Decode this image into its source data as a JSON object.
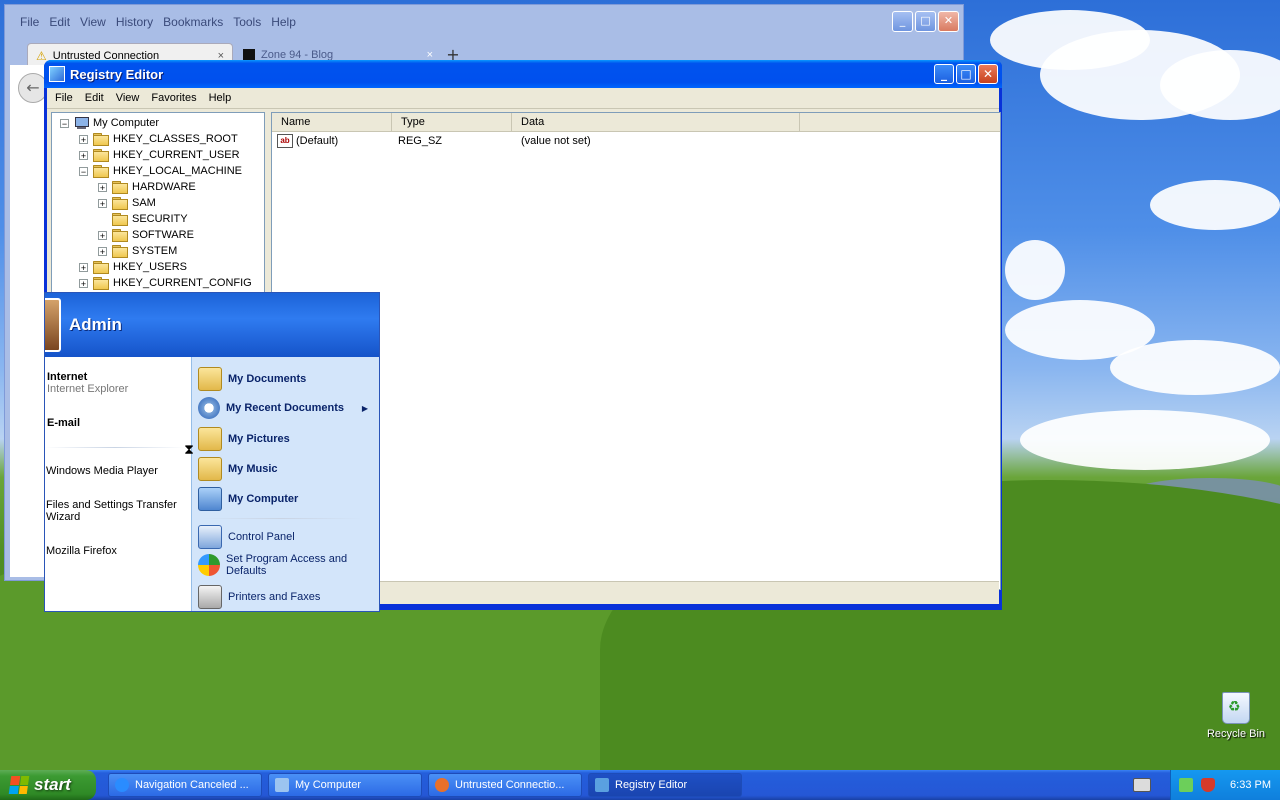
{
  "firefox": {
    "menu": [
      "File",
      "Edit",
      "View",
      "History",
      "Bookmarks",
      "Tools",
      "Help"
    ],
    "tabs": [
      {
        "label": "Untrusted Connection",
        "close": "×"
      },
      {
        "label": "Zone 94 - Blog",
        "close": "×"
      }
    ],
    "new_tab": "+"
  },
  "registry": {
    "title": "Registry Editor",
    "menu": [
      "File",
      "Edit",
      "View",
      "Favorites",
      "Help"
    ],
    "tree": [
      {
        "label": "My Computer",
        "expander": "−"
      },
      {
        "label": "HKEY_CLASSES_ROOT",
        "expander": "+"
      },
      {
        "label": "HKEY_CURRENT_USER",
        "expander": "+"
      },
      {
        "label": "HKEY_LOCAL_MACHINE",
        "expander": "−"
      },
      {
        "label": "HARDWARE",
        "expander": "+"
      },
      {
        "label": "SAM",
        "expander": "+"
      },
      {
        "label": "SECURITY",
        "expander": ""
      },
      {
        "label": "SOFTWARE",
        "expander": "+"
      },
      {
        "label": "SYSTEM",
        "expander": "+"
      },
      {
        "label": "HKEY_USERS",
        "expander": "+"
      },
      {
        "label": "HKEY_CURRENT_CONFIG",
        "expander": "+"
      }
    ],
    "columns": [
      "Name",
      "Type",
      "Data"
    ],
    "rows": [
      {
        "name": "(Default)",
        "type": "REG_SZ",
        "data": "(value not set)",
        "icon": "ab"
      }
    ]
  },
  "start_menu": {
    "user": "Admin",
    "pinned": [
      {
        "label": "Internet",
        "sub": "Internet Explorer"
      },
      {
        "label": "E-mail",
        "sub": ""
      }
    ],
    "recent": [
      "Windows Media Player",
      "Files and Settings Transfer Wizard",
      "Mozilla Firefox"
    ],
    "places": [
      {
        "label": "My Documents",
        "icon": "folder-icon"
      },
      {
        "label": "My Recent Documents",
        "icon": "recent-documents-icon",
        "arrow": "▶"
      },
      {
        "label": "My Pictures",
        "icon": "folder-icon"
      },
      {
        "label": "My Music",
        "icon": "folder-icon"
      },
      {
        "label": "My Computer",
        "icon": "computer-icon"
      }
    ],
    "system": [
      {
        "label": "Control Panel",
        "icon": "control-panel-icon"
      },
      {
        "label": "Set Program Access and Defaults",
        "icon": "program-access-icon"
      },
      {
        "label": "Printers and Faxes",
        "icon": "printer-icon"
      }
    ]
  },
  "desktop": {
    "recycle_bin": "Recycle Bin"
  },
  "taskbar": {
    "start": "start",
    "tasks": [
      {
        "label": "Navigation Canceled ...",
        "icon_color": "#2a8cff"
      },
      {
        "label": "My Computer",
        "icon_color": "#9cc4f0"
      },
      {
        "label": "Untrusted Connectio...",
        "icon_color": "#e8702a"
      },
      {
        "label": "Registry Editor",
        "icon_color": "#5aa0e0"
      }
    ],
    "clock": "6:33 PM"
  }
}
